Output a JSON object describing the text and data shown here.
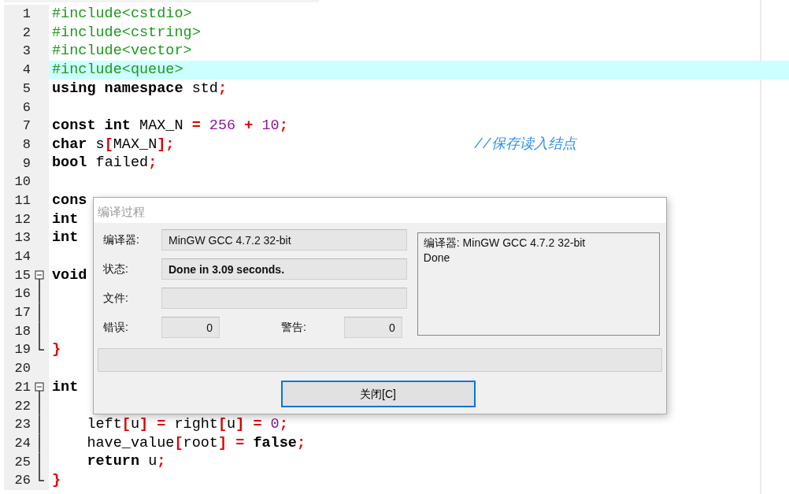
{
  "editor": {
    "lines": [
      {
        "number": "1",
        "current": false,
        "kind": "plain",
        "tokens": [
          {
            "kind": "pp",
            "text": "#include<cstdio>"
          }
        ]
      },
      {
        "number": "2",
        "current": false,
        "kind": "plain",
        "tokens": [
          {
            "kind": "pp",
            "text": "#include<cstring>"
          }
        ]
      },
      {
        "number": "3",
        "current": false,
        "kind": "plain",
        "tokens": [
          {
            "kind": "pp",
            "text": "#include<vector>"
          }
        ]
      },
      {
        "number": "4",
        "current": true,
        "kind": "plain",
        "tokens": [
          {
            "kind": "pp",
            "text": "#include<queue>"
          }
        ]
      },
      {
        "number": "5",
        "current": false,
        "kind": "plain",
        "tokens": [
          {
            "kind": "kw",
            "text": "using namespace"
          },
          {
            "kind": "id",
            "text": " std"
          },
          {
            "kind": "op",
            "text": ";"
          }
        ]
      },
      {
        "number": "6",
        "current": false,
        "kind": "plain"
      },
      {
        "number": "7",
        "current": false,
        "kind": "plain",
        "tokens": [
          {
            "kind": "kw",
            "text": "const int"
          },
          {
            "kind": "id",
            "text": " MAX_N "
          },
          {
            "kind": "op",
            "text": "="
          },
          {
            "kind": "num",
            "text": " 256 "
          },
          {
            "kind": "op",
            "text": "+"
          },
          {
            "kind": "num",
            "text": " 10"
          },
          {
            "kind": "op",
            "text": ";"
          }
        ]
      },
      {
        "number": "8",
        "current": false,
        "kind": "plain",
        "tokens": [
          {
            "kind": "kw",
            "text": "char"
          },
          {
            "kind": "id",
            "text": " s"
          },
          {
            "kind": "op",
            "text": "["
          },
          {
            "kind": "id",
            "text": "MAX_N"
          },
          {
            "kind": "op",
            "text": "];"
          }
        ],
        "comment": "//保存读入结点"
      },
      {
        "number": "9",
        "current": false,
        "kind": "plain",
        "tokens": [
          {
            "kind": "kw",
            "text": "bool"
          },
          {
            "kind": "id",
            "text": " failed"
          },
          {
            "kind": "op",
            "text": ";"
          }
        ]
      },
      {
        "number": "10",
        "current": false,
        "kind": "plain"
      },
      {
        "number": "11",
        "current": false,
        "kind": "plain",
        "tokens": [
          {
            "kind": "kw",
            "text": "cons"
          }
        ]
      },
      {
        "number": "12",
        "current": false,
        "kind": "plain",
        "tokens": [
          {
            "kind": "kw",
            "text": "int"
          }
        ]
      },
      {
        "number": "13",
        "current": false,
        "kind": "plain",
        "tokens": [
          {
            "kind": "kw",
            "text": "int"
          }
        ]
      },
      {
        "number": "14",
        "current": false,
        "kind": "plain"
      },
      {
        "number": "15",
        "current": false,
        "kind": "fold-start",
        "tokens": [
          {
            "kind": "kw",
            "text": "void"
          }
        ]
      },
      {
        "number": "16",
        "current": false,
        "kind": "fold-line"
      },
      {
        "number": "17",
        "current": false,
        "kind": "fold-line"
      },
      {
        "number": "18",
        "current": false,
        "kind": "fold-line"
      },
      {
        "number": "19",
        "current": false,
        "kind": "fold-end",
        "tokens": [
          {
            "kind": "op",
            "text": "}"
          }
        ]
      },
      {
        "number": "20",
        "current": false,
        "kind": "plain"
      },
      {
        "number": "21",
        "current": false,
        "kind": "fold-start",
        "tokens": [
          {
            "kind": "kw",
            "text": "int"
          }
        ]
      },
      {
        "number": "22",
        "current": false,
        "kind": "fold-line"
      },
      {
        "number": "23",
        "current": false,
        "kind": "fold-line",
        "tokens": [
          {
            "kind": "id",
            "text": "    left"
          },
          {
            "kind": "op",
            "text": "["
          },
          {
            "kind": "id",
            "text": "u"
          },
          {
            "kind": "op",
            "text": "] ="
          },
          {
            "kind": "id",
            "text": " right"
          },
          {
            "kind": "op",
            "text": "["
          },
          {
            "kind": "id",
            "text": "u"
          },
          {
            "kind": "op",
            "text": "] ="
          },
          {
            "kind": "num",
            "text": " 0"
          },
          {
            "kind": "op",
            "text": ";"
          }
        ]
      },
      {
        "number": "24",
        "current": false,
        "kind": "fold-line",
        "tokens": [
          {
            "kind": "id",
            "text": "    have_value"
          },
          {
            "kind": "op",
            "text": "["
          },
          {
            "kind": "id",
            "text": "root"
          },
          {
            "kind": "op",
            "text": "] ="
          },
          {
            "kind": "kw",
            "text": " false"
          },
          {
            "kind": "op",
            "text": ";"
          }
        ]
      },
      {
        "number": "25",
        "current": false,
        "kind": "fold-line",
        "tokens": [
          {
            "kind": "kw",
            "text": "    return"
          },
          {
            "kind": "id",
            "text": " u"
          },
          {
            "kind": "op",
            "text": ";"
          }
        ]
      },
      {
        "number": "26",
        "current": false,
        "kind": "fold-end",
        "tokens": [
          {
            "kind": "op",
            "text": "}"
          }
        ]
      }
    ]
  },
  "dialog": {
    "title": "编译过程",
    "rows": [
      {
        "label": "编译器:",
        "value": "MinGW GCC 4.7.2 32-bit",
        "bold": false
      },
      {
        "label": "状态:",
        "value": "Done in 3.09 seconds.",
        "bold": true
      },
      {
        "label": "文件:"
      }
    ],
    "errors": {
      "label": "错误:",
      "value": "0"
    },
    "warnings": {
      "label": "警告:",
      "value": "0"
    },
    "log": [
      "编译器: MinGW GCC 4.7.2 32-bit",
      "Done"
    ],
    "progress": {
      "level": 0
    },
    "close_button": "关闭[C]"
  }
}
